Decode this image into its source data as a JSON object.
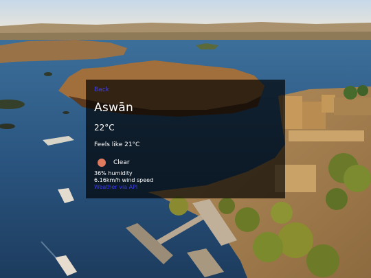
{
  "card": {
    "search_link": "Back",
    "city": "Aswān",
    "temperature": "22°C",
    "feels_like": "Feels like 21°C",
    "condition": "Clear",
    "humidity": "36% humidity",
    "wind": "6.16km/h wind speed",
    "credit": "Weather via API"
  },
  "colors": {
    "overlay": "#000000",
    "link": "#3d3df0",
    "condition_icon": "#e07a5f"
  },
  "icons": {
    "condition": "sun-icon"
  }
}
